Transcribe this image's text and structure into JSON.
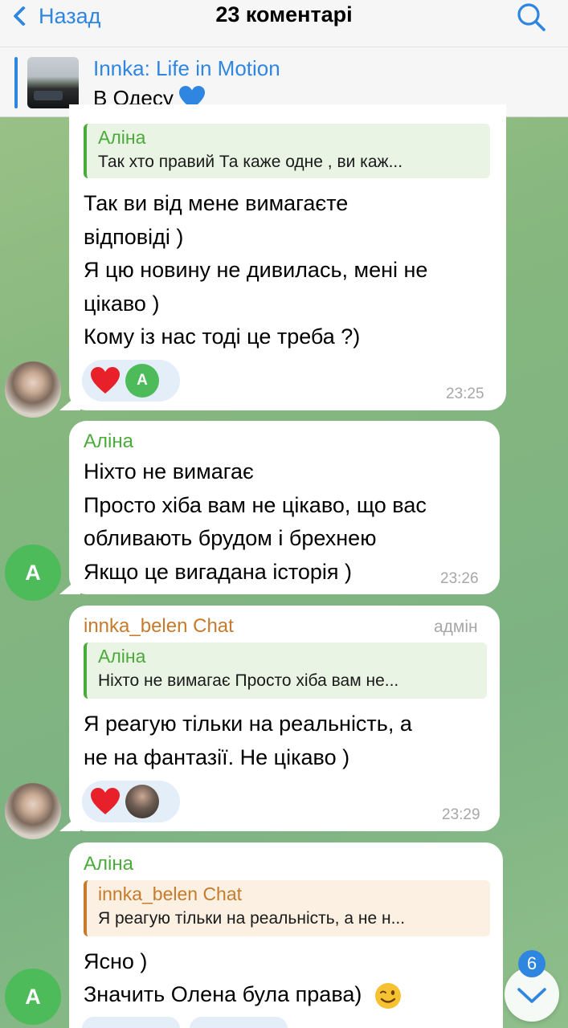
{
  "header": {
    "back_label": "Назад",
    "title": "23 коментарі"
  },
  "pinned": {
    "title": "Innka: Life in Motion",
    "text": "В Одесу"
  },
  "messages": [
    {
      "quote_name": "Аліна",
      "quote_text": "Так хто правий Та каже одне , ви каж...",
      "lines": [
        "Так ви від мене вимагаєте",
        "відповіді )",
        "Я цю новину не дивилась, мені не",
        "цікаво )",
        "Кому із нас тоді це треба ?)"
      ],
      "reaction_avatar": "А",
      "time": "23:25"
    },
    {
      "sender": "Аліна",
      "lines": [
        "Ніхто не вимагає",
        "Просто хіба вам не цікаво, що вас",
        "обливають брудом і брехнею",
        "Якщо це вигадана історія )"
      ],
      "time": "23:26",
      "avatar": "A"
    },
    {
      "sender": "innka_belen Chat",
      "admin": "адмін",
      "quote_name": "Аліна",
      "quote_text": "Ніхто не вимагає Просто хіба вам не...",
      "lines": [
        "Я реагую тільки на реальність, а",
        "не на фантазії. Не цікаво )"
      ],
      "time": "23:29"
    },
    {
      "sender": "Аліна",
      "quote_name": "innka_belen Chat",
      "quote_text": "Я реагую тільки на реальність, а не н...",
      "lines": [
        "Ясно )",
        "Значить Олена була права)"
      ],
      "avatar": "A"
    }
  ],
  "scroll": {
    "unread_count": "6"
  },
  "colors": {
    "accent": "#2f86e0",
    "sender_green": "#4bab3a",
    "admin_orange": "#c77a2a"
  }
}
